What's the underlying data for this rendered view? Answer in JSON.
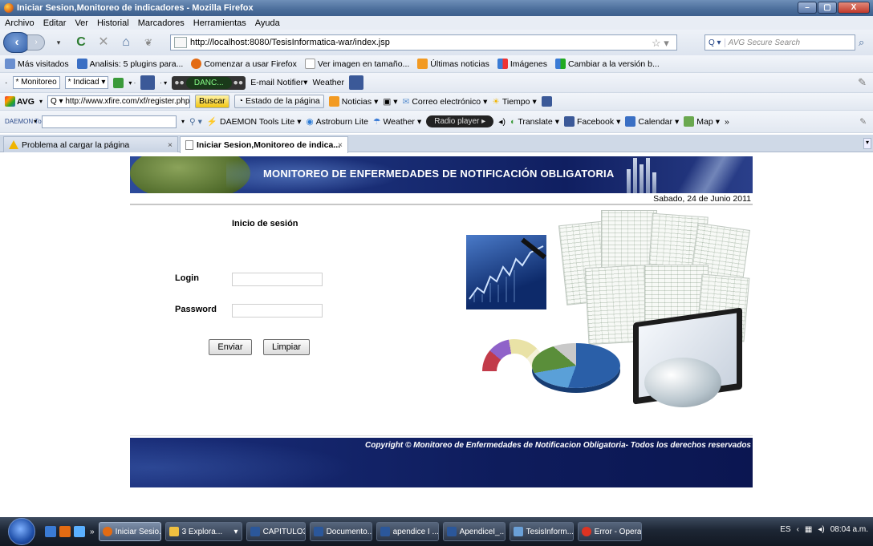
{
  "window": {
    "title": "Iniciar Sesion,Monitoreo de indicadores - Mozilla Firefox",
    "controls": [
      "–",
      "▢",
      "X"
    ]
  },
  "menu": [
    "Archivo",
    "Editar",
    "Ver",
    "Historial",
    "Marcadores",
    "Herramientas",
    "Ayuda"
  ],
  "nav": {
    "url": "http://localhost:8080/TesisInformatica-war/index.jsp",
    "search_engine": "Q ▾",
    "search_placeholder": "AVG Secure Search"
  },
  "bookmarks": [
    "Más visitados",
    "Analisis: 5 plugins para...",
    "Comenzar a usar Firefox",
    "Ver imagen en tamaño...",
    "Últimas noticias",
    "Imágenes",
    "Cambiar a la versión b..."
  ],
  "toolbar2": {
    "combo1": "* Monitoreo",
    "combo2": "* Indicad",
    "dark_label": "DANC...",
    "email_notifier": "E-mail Notifier",
    "weather": "Weather"
  },
  "toolbar3": {
    "brand": "AVG",
    "search_value": "http://www.xfire.com/xf/register.php",
    "buscar": "Buscar",
    "estado": "Estado de la página",
    "noticias": "Noticias",
    "correo": "Correo electrónico",
    "tiempo": "Tiempo"
  },
  "toolbar4": {
    "brand": "DAEMON Tools",
    "daemon_lite": "DAEMON Tools Lite",
    "astroburn": "Astroburn Lite",
    "weather": "Weather",
    "radio": "Radio player",
    "translate": "Translate",
    "facebook": "Facebook",
    "calendar": "Calendar",
    "map": "Map"
  },
  "tabs": [
    {
      "label": "Problema al cargar la página",
      "close": "×"
    },
    {
      "label": "Iniciar Sesion,Monitoreo de indica...",
      "close": "×"
    }
  ],
  "page": {
    "banner_title": "MONITOREO DE ENFERMEDADES DE NOTIFICACIÓN OBLIGATORIA",
    "date": "Sabado, 24 de Junio 2011",
    "login_title": "Inicio de sesión",
    "login_label": "Login",
    "password_label": "Password",
    "login_value": "",
    "password_value": "",
    "submit_label": "Enviar",
    "reset_label": "Limpiar",
    "footer": "Copyright © Monitoreo de Enfermedades de Notificacion Obligatoria- Todos los derechos reservados"
  },
  "taskbar": {
    "items": [
      "Iniciar Sesio...",
      "3 Explora...",
      "CAPITULO3...",
      "Documento...",
      "apendice I ...",
      "ApendiceI_...",
      "TesisInform...",
      "Error - Opera"
    ],
    "lang": "ES",
    "clock": "08:04 a.m."
  }
}
